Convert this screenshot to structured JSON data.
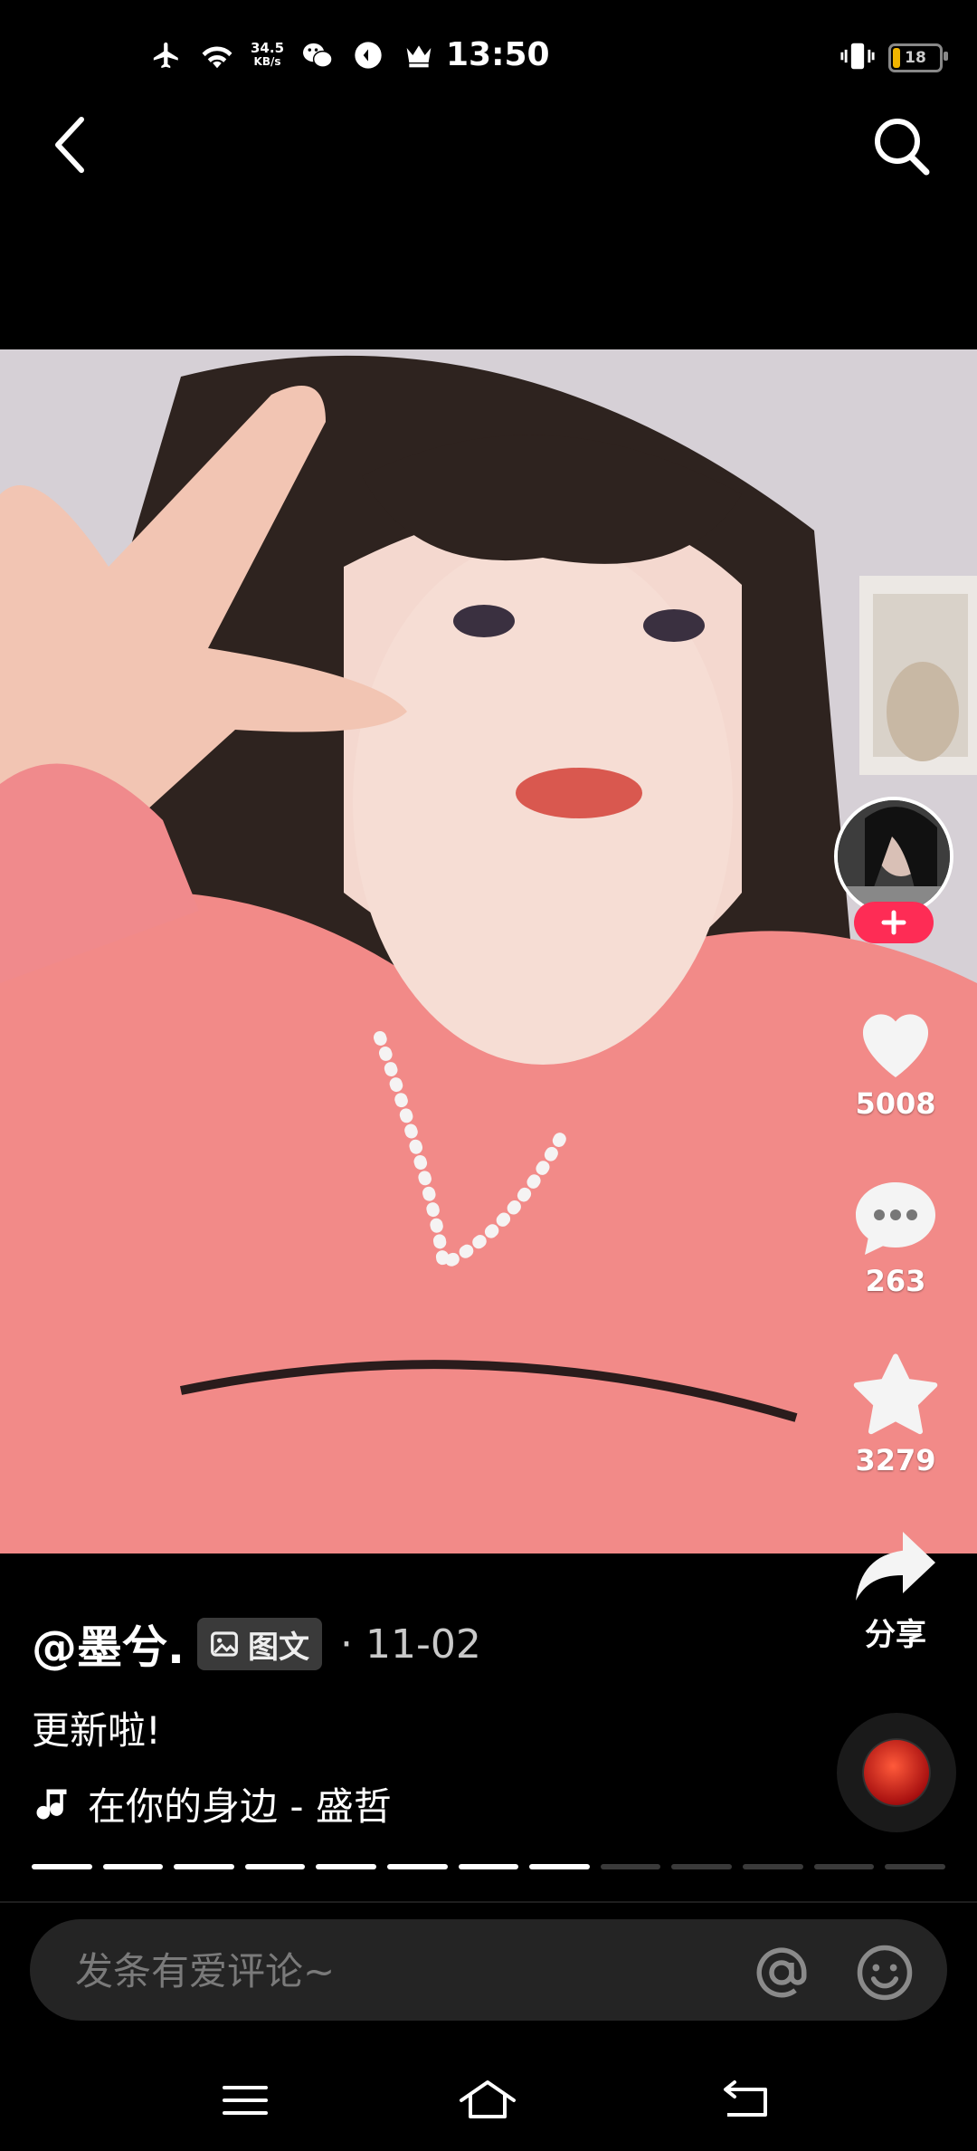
{
  "status_bar": {
    "time": "13:50",
    "net_speed_value": "34.5",
    "net_speed_unit": "KB/s",
    "battery": "18",
    "icons": [
      "airplane-icon",
      "wifi-icon",
      "wechat-icon",
      "app-icon",
      "crown-icon",
      "vibrate-icon",
      "battery-icon"
    ]
  },
  "nav": {
    "back_icon": "back-chevron-icon",
    "search_icon": "search-icon"
  },
  "actions": {
    "likes": "5008",
    "comments": "263",
    "favorites": "3279",
    "share_label": "分享"
  },
  "post": {
    "author": "@墨兮.",
    "type_badge": "图文",
    "date": "· 11-02",
    "description": "更新啦!",
    "music": "在你的身边 - 盛哲"
  },
  "progress": {
    "total": 13,
    "current": 8
  },
  "comment_bar": {
    "placeholder": "发条有爱评论~"
  },
  "colors": {
    "accent": "#fe2c55",
    "background": "#000000"
  }
}
